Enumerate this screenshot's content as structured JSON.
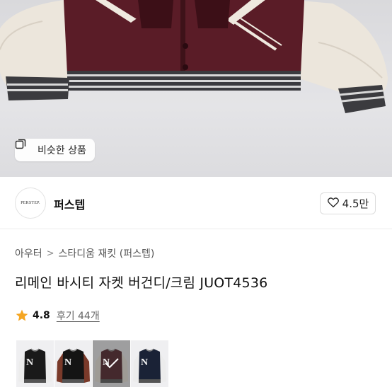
{
  "hero": {
    "similar_button_label": "비슷한 상품",
    "similar_icon": "copy-icon"
  },
  "seller": {
    "logo_text": "PERSTEP.",
    "name": "퍼스텝",
    "likes": "4.5만",
    "like_icon": "heart-icon"
  },
  "breadcrumb": {
    "category": "아우터",
    "separator": ">",
    "subcategory": "스타디움 재킷 (퍼스텝)"
  },
  "product": {
    "title": "리메인 바시티 자켓 버건디/크림 JUOT4536",
    "rating": "4.8",
    "reviews": "후기 44개",
    "rating_icon": "star-icon",
    "star_color": "#f5a623"
  },
  "variants": [
    {
      "name": "black-white",
      "body_color": "#1a1a1a",
      "sleeve_color": "#ececec",
      "letter": "N",
      "selected": false
    },
    {
      "name": "black-brown",
      "body_color": "#141414",
      "sleeve_color": "#7a3a2a",
      "letter": "N",
      "selected": false
    },
    {
      "name": "burgundy-cream",
      "body_color": "#4b1a22",
      "sleeve_color": "#efe9df",
      "letter": "N",
      "selected": true
    },
    {
      "name": "navy-white",
      "body_color": "#1a2236",
      "sleeve_color": "#ececec",
      "letter": "N",
      "selected": false
    }
  ]
}
